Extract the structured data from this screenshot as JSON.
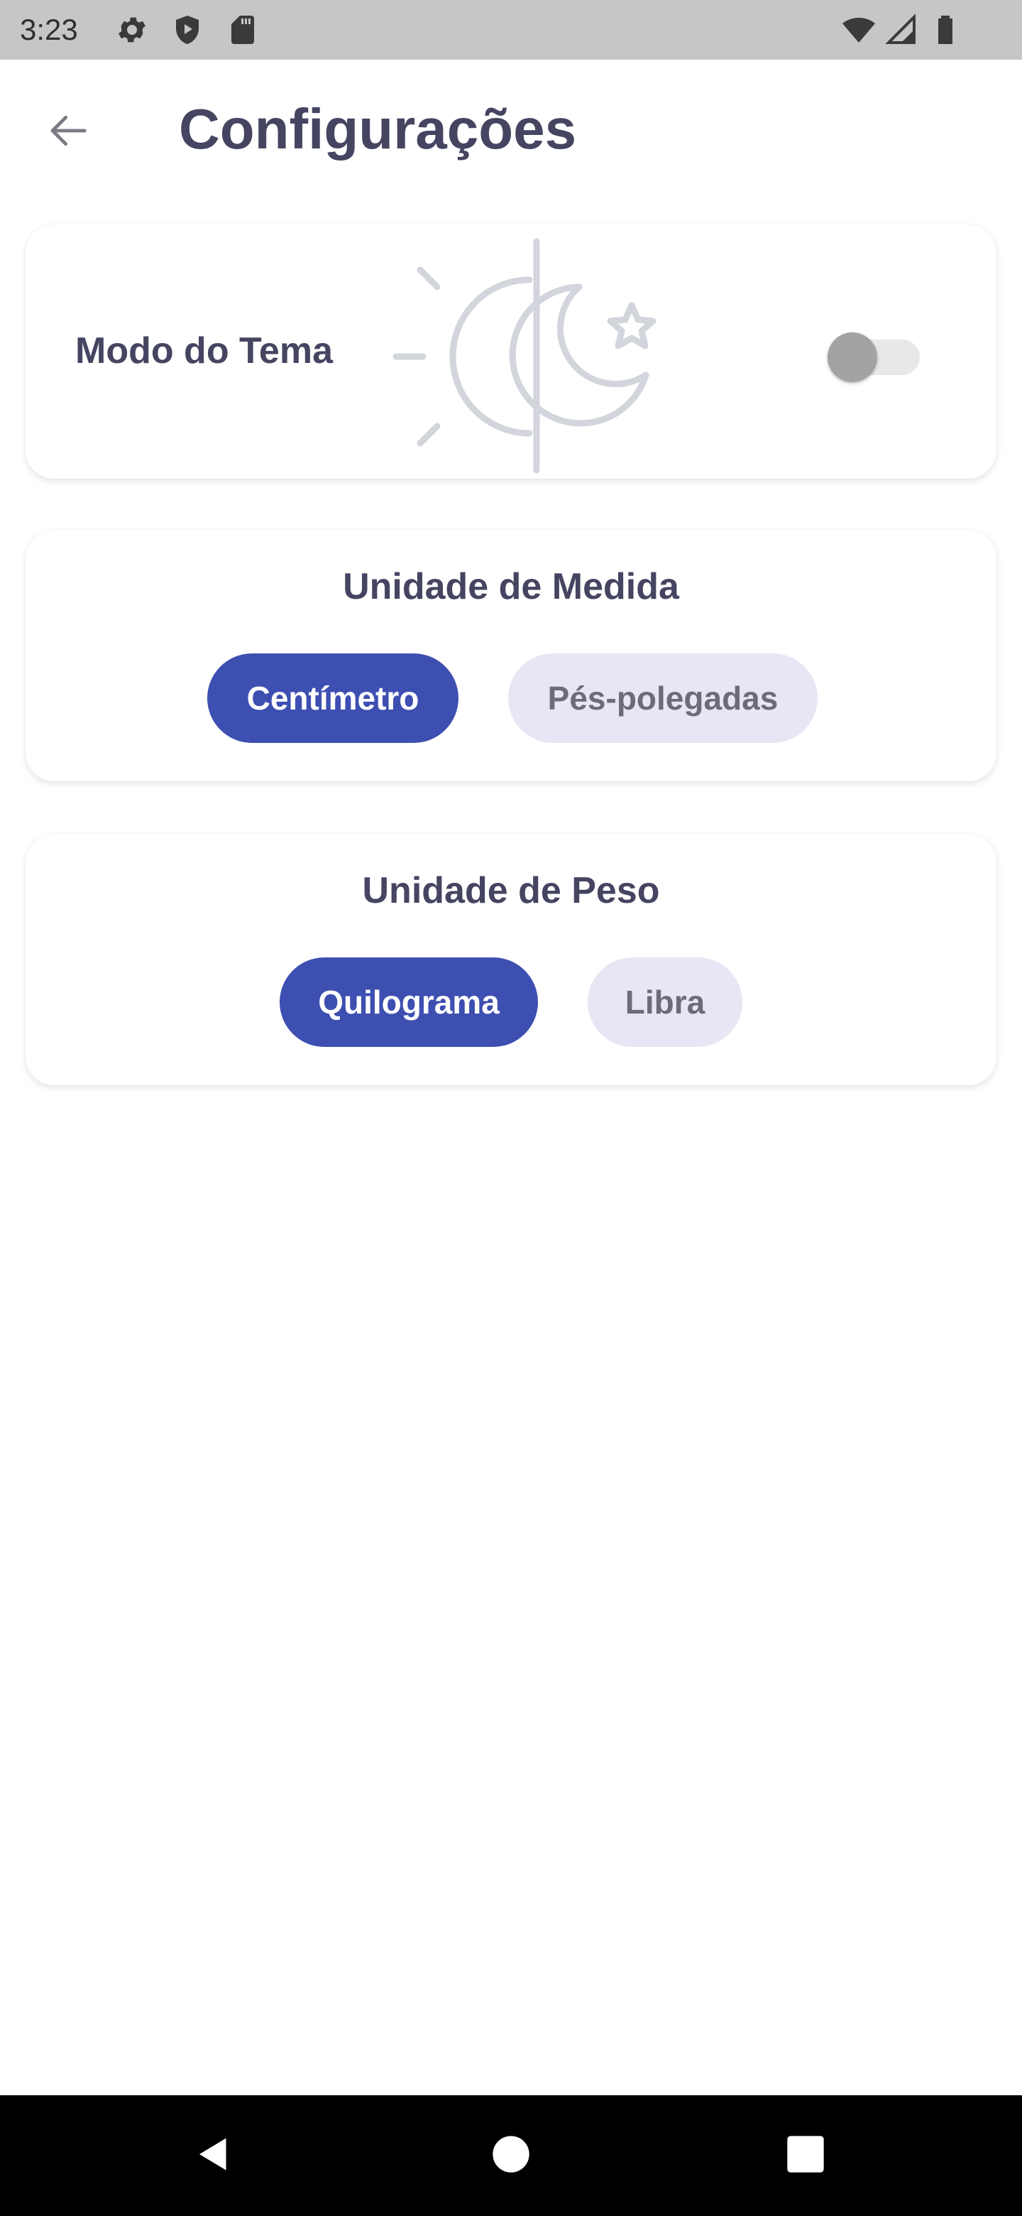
{
  "status_bar": {
    "time": "3:23",
    "left_icons": [
      "settings-gear-icon",
      "shield-play-icon",
      "sd-card-icon"
    ],
    "right_icons": [
      "wifi-icon",
      "cellular-signal-icon",
      "battery-icon"
    ]
  },
  "app_bar": {
    "back_icon": "arrow-back-icon",
    "title": "Configurações"
  },
  "theme_card": {
    "label": "Modo do Tema",
    "illustration_icon": "sun-moon-star-icon",
    "toggle_on": false
  },
  "measure_card": {
    "heading": "Unidade de Medida",
    "options": [
      {
        "label": "Centímetro",
        "selected": true
      },
      {
        "label": "Pés-polegadas",
        "selected": false
      }
    ]
  },
  "weight_card": {
    "heading": "Unidade de Peso",
    "options": [
      {
        "label": "Quilograma",
        "selected": true
      },
      {
        "label": "Libra",
        "selected": false
      }
    ]
  },
  "nav_bar": {
    "icons": [
      "nav-back-icon",
      "nav-home-icon",
      "nav-recents-icon"
    ]
  },
  "colors": {
    "primary": "#3e4fb2",
    "chip_unselected_bg": "#e8e6f4",
    "title_text": "#454562",
    "status_bar_bg": "#c6c6c6"
  }
}
